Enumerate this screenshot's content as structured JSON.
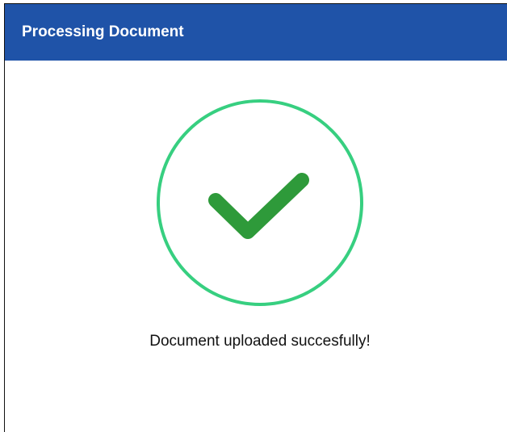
{
  "dialog": {
    "title": "Processing Document",
    "message": "Document uploaded succesfully!",
    "icon": "checkmark-circle-icon"
  },
  "colors": {
    "header_bg": "#1f53a8",
    "header_text": "#ffffff",
    "circle_stroke": "#37cf80",
    "checkmark": "#2e9a3a",
    "message_text": "#111111",
    "background": "#ffffff"
  }
}
